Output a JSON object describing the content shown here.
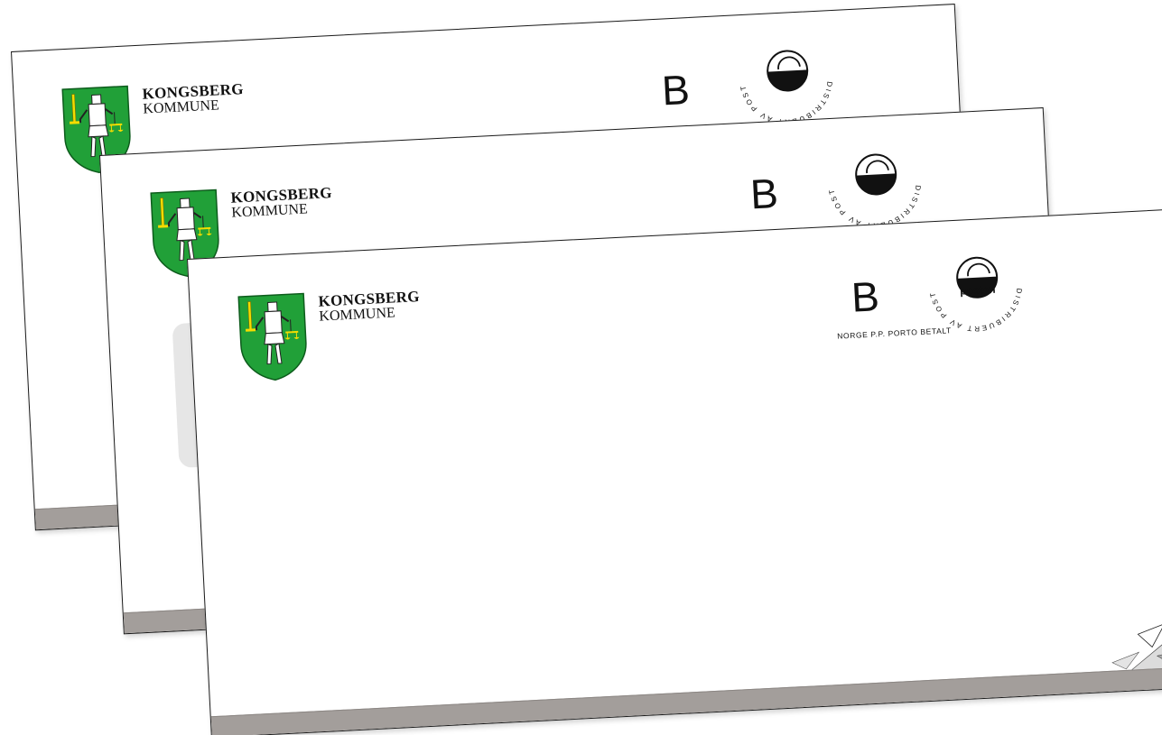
{
  "brand": {
    "name": "KONGSBERG",
    "subtitle": "KOMMUNE"
  },
  "postage": {
    "class_letter": "B",
    "porto_text": "NORGE P.P. PORTO BETALT",
    "ring_text": "DISTRIBUERT AV POSTEN NORGE",
    "logo_word": "posten"
  },
  "colors": {
    "crest_green": "#21a038",
    "crest_yellow": "#f3dc00",
    "stripe_grey": "#a39e9b",
    "window_grey": "#e6e6e6"
  },
  "envelopes": [
    {
      "id": "back"
    },
    {
      "id": "middle"
    },
    {
      "id": "front"
    }
  ]
}
